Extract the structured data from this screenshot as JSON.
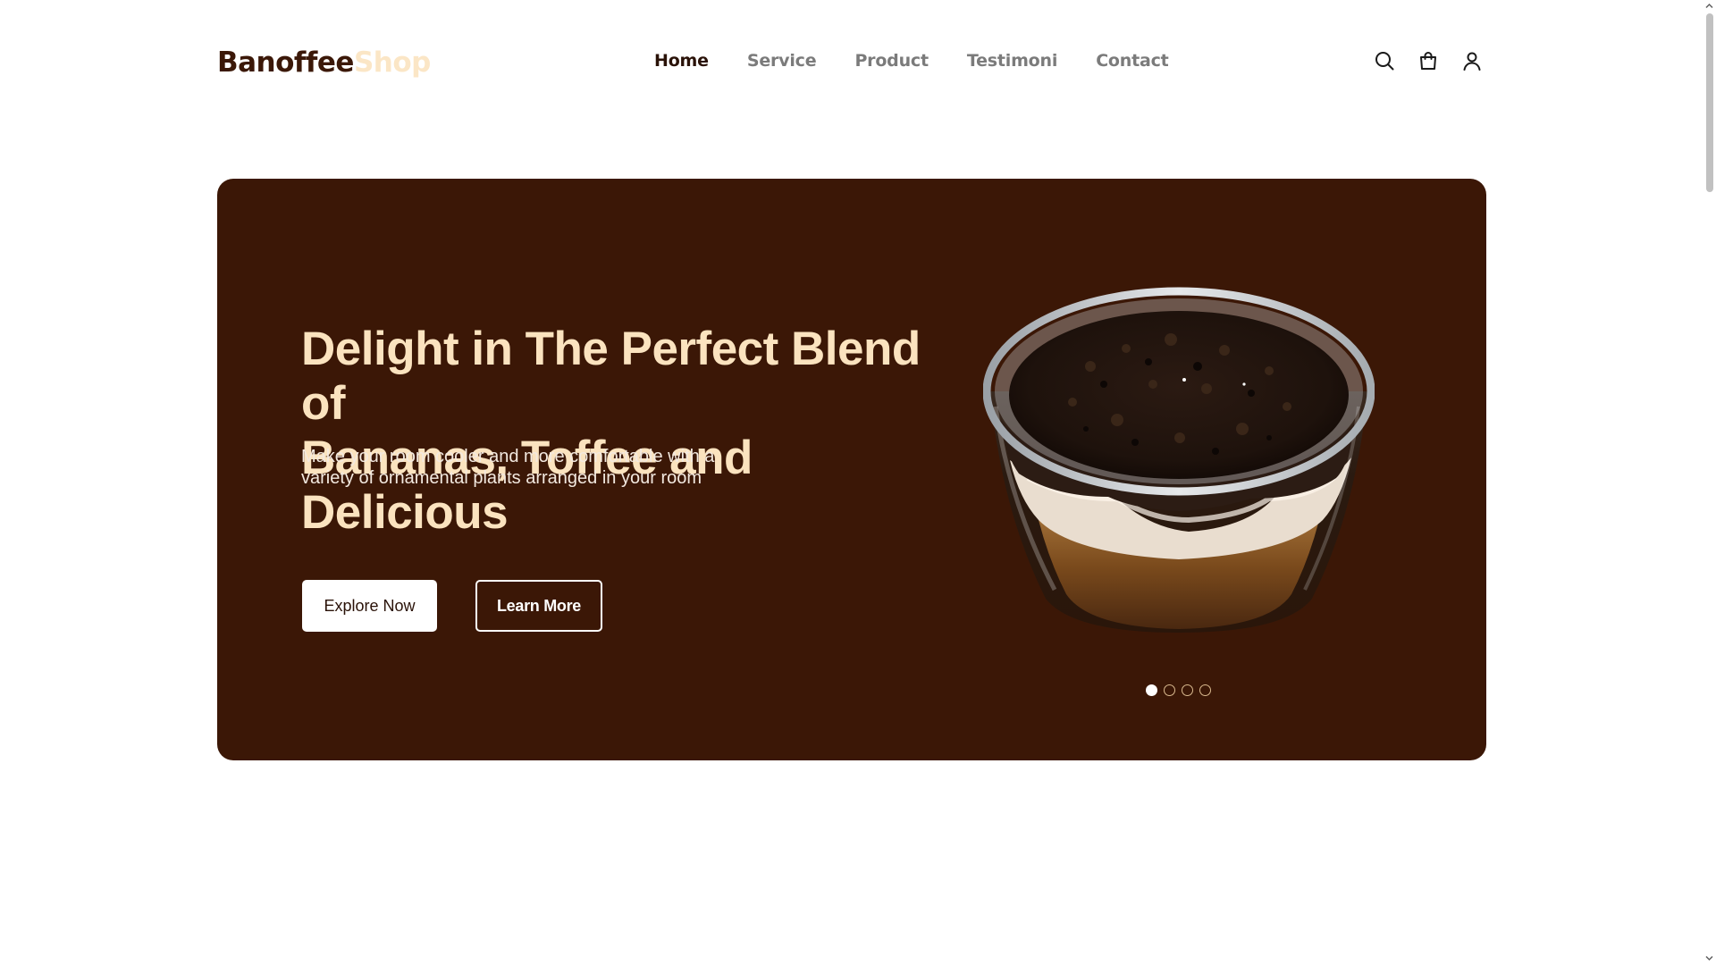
{
  "header": {
    "logo_part1": "Banoffee",
    "logo_part2": "Shop",
    "nav": [
      {
        "label": "Home",
        "active": true
      },
      {
        "label": "Service",
        "active": false
      },
      {
        "label": "Product",
        "active": false
      },
      {
        "label": "Testimoni",
        "active": false
      },
      {
        "label": "Contact",
        "active": false
      }
    ],
    "icons": [
      "search-icon",
      "shopping-bag-icon",
      "user-icon"
    ]
  },
  "hero": {
    "title_line1": "Delight in The Perfect Blend of",
    "title_line2": "Bananas, Toffee and Delicious",
    "subtitle_line1": "Make your room cooler and more comfortable with a",
    "subtitle_line2": "variety of ornamental plants arranged in your room",
    "explore_label": "Explore Now",
    "learn_label": "Learn More",
    "carousel_total": 4,
    "carousel_active": 1
  },
  "colors": {
    "brand_dark": "#3b1706",
    "brand_cream": "#fbe3bf",
    "nav_inactive": "#7b7b7b"
  }
}
